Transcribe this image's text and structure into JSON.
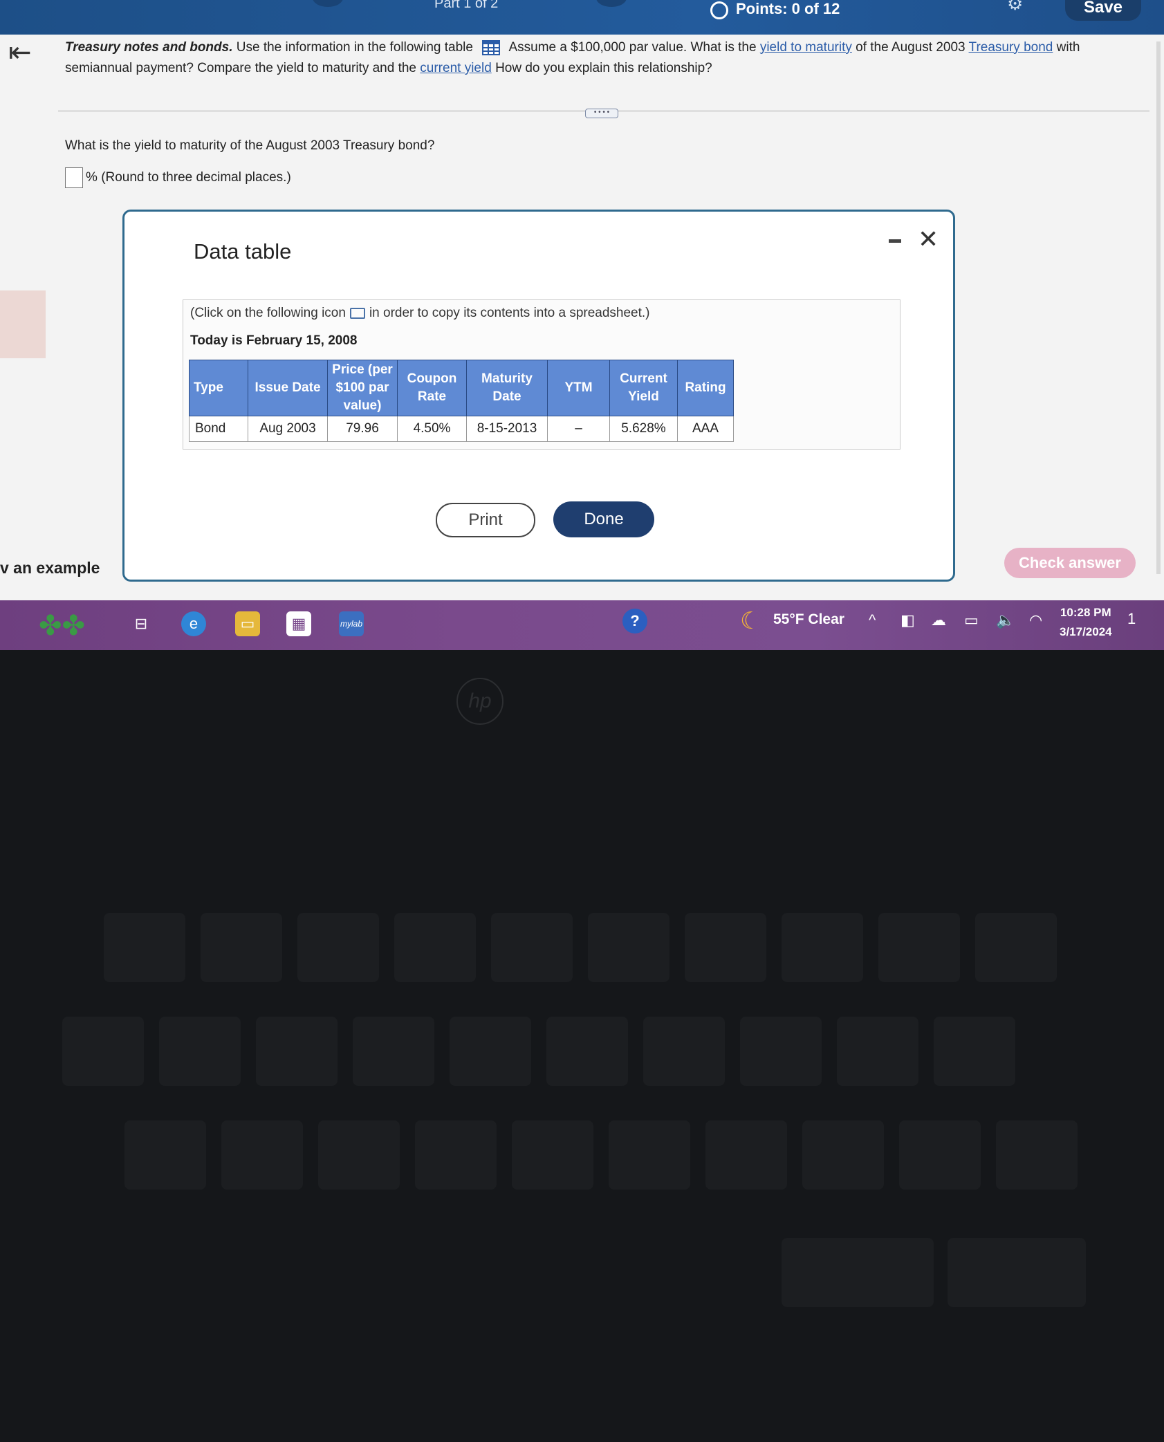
{
  "header": {
    "part": "Part 1 of 2",
    "points": "Points: 0 of 12",
    "save_label": "Save"
  },
  "question": {
    "lead": "Treasury notes and bonds.",
    "text1": "Use the information in the following table",
    "text2": "Assume a $100,000 par value. What is the",
    "link_ytm": "yield to maturity",
    "text3": "of the August 2003",
    "link_bond": "Treasury bond",
    "text4": "with semiannual payment? Compare the yield to maturity and the",
    "link_cy": "current yield",
    "text5": "How do you explain this relationship?"
  },
  "subquestion": "What is the yield to maturity of the August 2003 Treasury bond?",
  "answer": {
    "unit": "%",
    "hint": "(Round to three decimal places.)"
  },
  "example_label": "v an example",
  "check_answer_label": "Check answer",
  "dialog": {
    "title": "Data table",
    "note_before": "(Click on the following icon",
    "note_after": "in order to copy its contents into a spreadsheet.)",
    "today": "Today is February 15, 2008",
    "headers": [
      "Type",
      "Issue Date",
      "Price (per $100 par value)",
      "Coupon Rate",
      "Maturity Date",
      "YTM",
      "Current Yield",
      "Rating"
    ],
    "rows": [
      [
        "Bond",
        "Aug 2003",
        "79.96",
        "4.50%",
        "8-15-2013",
        "–",
        "5.628%",
        "AAA"
      ]
    ],
    "print_label": "Print",
    "done_label": "Done"
  },
  "taskbar": {
    "weather": "55°F  Clear",
    "time": "10:28 PM",
    "date": "3/17/2024",
    "notifications": "1",
    "help_icon": "?",
    "apps": [
      "task-view-icon",
      "edge-icon",
      "file-explorer-icon",
      "store-icon",
      "mylab-icon"
    ]
  },
  "laptop": {
    "brand": "hp"
  }
}
